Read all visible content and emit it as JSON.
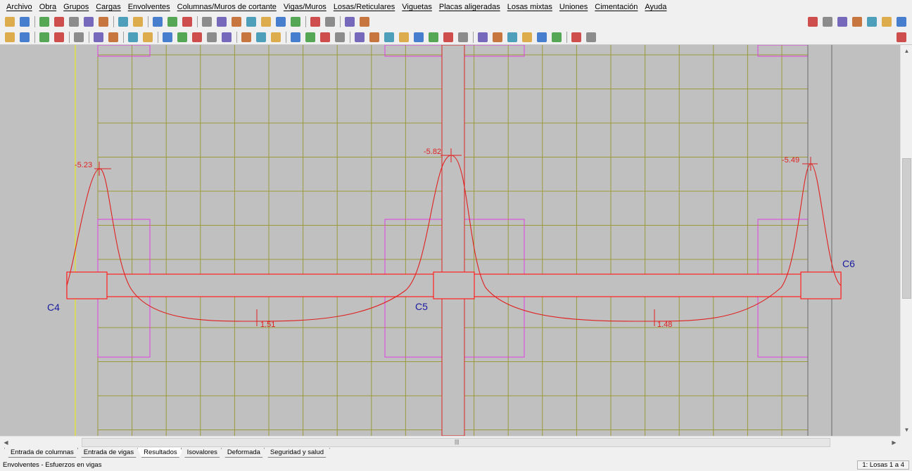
{
  "menu": [
    "Archivo",
    "Obra",
    "Grupos",
    "Cargas",
    "Envolventes",
    "Columnas/Muros de cortante",
    "Vigas/Muros",
    "Losas/Reticulares",
    "Viguetas",
    "Placas aligeradas",
    "Losas mixtas",
    "Uniones",
    "Cimentación",
    "Ayuda"
  ],
  "toolbar1_icons": [
    "open-icon",
    "save-icon",
    "column-icon",
    "beam-icon",
    "grid-icon",
    "table-icon",
    "magnet-icon",
    "undo-icon",
    "redo-icon",
    "floor-up-icon",
    "floor-select-icon",
    "floor-down-icon",
    "zoom-window-icon",
    "zoom-all-icon",
    "zoom-in-icon",
    "zoom-out-icon",
    "zoom-previous-icon",
    "pan-icon",
    "redraw-icon",
    "layers-icon",
    "measure-icon",
    "angle-icon",
    "axis-icon"
  ],
  "toolbar1_right_icons": [
    "help-icon",
    "web-icon",
    "cd-icon",
    "update-icon",
    "exit-icon",
    "window-icon",
    "tile-icon"
  ],
  "toolbar2_icons": [
    "views-icon",
    "3d-view-icon",
    "stair-icon",
    "select-icon",
    "info-icon",
    "box-icon",
    "cube-icon",
    "edit-icon",
    "load-icon",
    "diagram-icon",
    "envelope-icon",
    "moment-icon",
    "shear-icon",
    "info-circle-icon",
    "error-icon",
    "report-icon",
    "plan-icon",
    "slab-icon",
    "rebar-icon",
    "mesh-icon",
    "grid-rebar-icon",
    "beam-rebar-1-icon",
    "beam-rebar-2-icon",
    "beam-rebar-3-icon",
    "beam-rebar-4-icon",
    "beam-rebar-5-icon",
    "beam-rebar-6-icon",
    "beam-rebar-7-icon",
    "beam-rebar-8-icon",
    "footing-1-icon",
    "footing-2-icon",
    "footing-3-icon",
    "footing-4-icon",
    "footing-5-icon",
    "footing-6-icon",
    "print-icon",
    "flag-icon"
  ],
  "toolbar2_right_icons": [
    "plot-icon"
  ],
  "columns": [
    {
      "label": "C4"
    },
    {
      "label": "C5"
    },
    {
      "label": "C6"
    }
  ],
  "diagram_labels": {
    "peak_c4": "-5.23",
    "peak_c5": "-5.82",
    "peak_c6": "-5.49",
    "span_1": "1.51",
    "span_2": "1.48"
  },
  "tabs": [
    {
      "label": "Entrada de columnas",
      "active": false
    },
    {
      "label": "Entrada de vigas",
      "active": false
    },
    {
      "label": "Resultados",
      "active": true
    },
    {
      "label": "Isovalores",
      "active": false
    },
    {
      "label": "Deformada",
      "active": false
    },
    {
      "label": "Seguridad y salud",
      "active": false
    }
  ],
  "status": {
    "text": "Envolventes - Esfuerzos en vigas",
    "panel": "1: Losas 1 a 4"
  },
  "colors": {
    "canvas_bg": "#c0c0c0",
    "grid": "#9a9a3c",
    "beam_outline": "#ff2020",
    "diagram": "#e02020",
    "slab_edge": "#e040e0",
    "column_label": "#1a1aa0",
    "axis_yellow": "#e8e820"
  }
}
